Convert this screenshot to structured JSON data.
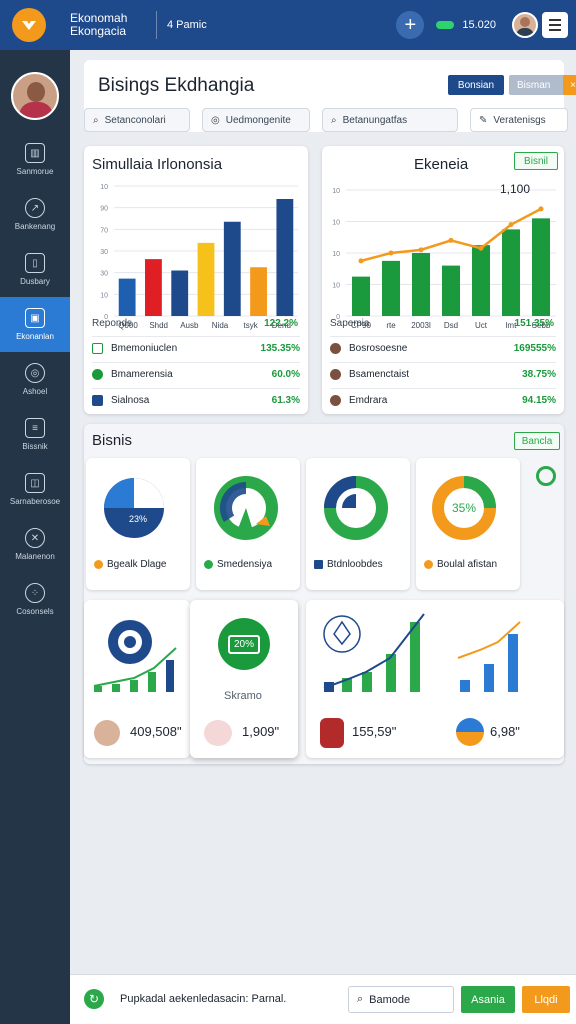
{
  "topbar": {
    "title_line1": "Ekonomah",
    "title_line2": "Ekongacia",
    "subtitle": "4 Pamic",
    "status_value": "15.020"
  },
  "sidebar": {
    "items": [
      {
        "label": "Sanmorue",
        "icon": "building-icon"
      },
      {
        "label": "Bankenang",
        "icon": "chart-line-icon"
      },
      {
        "label": "Dusbary",
        "icon": "book-icon"
      },
      {
        "label": "Ekonanlan",
        "icon": "window-icon",
        "active": true
      },
      {
        "label": "Ashoel",
        "icon": "globe-icon"
      },
      {
        "label": "Bissnik",
        "icon": "document-icon"
      },
      {
        "label": "Sarnaberosoe",
        "icon": "briefcase-icon"
      },
      {
        "label": "Malanenon",
        "icon": "person-icon"
      },
      {
        "label": "Cosonsels",
        "icon": "network-icon"
      }
    ]
  },
  "header": {
    "title": "Bisings Ekdhangia",
    "btn_primary": "Bonsian",
    "btn_secondary": "Bisman",
    "btn_close": "×",
    "search1": "Setanconolari",
    "search2": "Uedmongenite",
    "search3": "Betanungatfas",
    "search4": "Veratenisgs"
  },
  "card_sim": {
    "title": "Simullaia Irlononsia",
    "y_ticks": [
      "10",
      "90",
      "70",
      "30",
      "30",
      "10",
      "0"
    ],
    "footer_left": "Reponds",
    "footer_right": "122.2%",
    "rows": [
      {
        "label": "Bmemoniuclen",
        "value": "135.35%"
      },
      {
        "label": "Bmamerensia",
        "value": "60.0%"
      },
      {
        "label": "Sialnosa",
        "value": "61.3%"
      }
    ]
  },
  "card_eko": {
    "title": "Ekeneia",
    "badge": "Bisnil",
    "peak_label": "1,100",
    "y_ticks": [
      "10",
      "10",
      "10",
      "10",
      "0"
    ],
    "footer_left": "Sapemia",
    "footer_right": "151.35%",
    "rows": [
      {
        "label": "Bosrosoesne",
        "value": "169555%"
      },
      {
        "label": "Bsamenctaist",
        "value": "38.75%"
      },
      {
        "label": "Emdrara",
        "value": "94.15%"
      }
    ]
  },
  "bisnis": {
    "title": "Bisnis",
    "badge": "Bancla",
    "donuts": [
      {
        "label": "Bgealk Dlage",
        "center": "23%",
        "color": "#f39a1c"
      },
      {
        "label": "Smedensiya",
        "center": "",
        "color": "#2aa84a"
      },
      {
        "label": "Btdnloobdes",
        "center": "",
        "color": "#1e4a8c"
      },
      {
        "label": "Boulal afistan",
        "center": "35%",
        "color": "#f39a1c"
      }
    ],
    "minis": [
      {
        "value": "409,508\""
      },
      {
        "value": "1,909\"",
        "caption": "Skramo",
        "badge": "20%"
      },
      {
        "value": "155,59\""
      },
      {
        "value": "6,98\""
      }
    ]
  },
  "footer": {
    "text": "Pupkadal aekenledasacin: Parnal.",
    "search": "Bamode",
    "btn1": "Asania",
    "btn2": "Llqdi"
  },
  "chart_data": [
    {
      "type": "bar",
      "title": "Simullaia Irlononsia",
      "categories": [
        "Q000",
        "Shdd",
        "Ausb",
        "Nida",
        "tsyk",
        "Dend"
      ],
      "series": [
        {
          "values": [
            23,
            35,
            28,
            45,
            58,
            30,
            72
          ]
        }
      ]
    },
    {
      "type": "bar",
      "title": "Ekeneia",
      "categories": [
        "CP90",
        "rte",
        "2003l",
        "Dsd",
        "Uct",
        "lmt",
        "Sebb"
      ],
      "series": [
        {
          "values": [
            25,
            35,
            40,
            32,
            45,
            55,
            62
          ]
        },
        {
          "values": [
            35,
            40,
            42,
            48,
            43,
            58,
            68
          ]
        }
      ]
    }
  ]
}
